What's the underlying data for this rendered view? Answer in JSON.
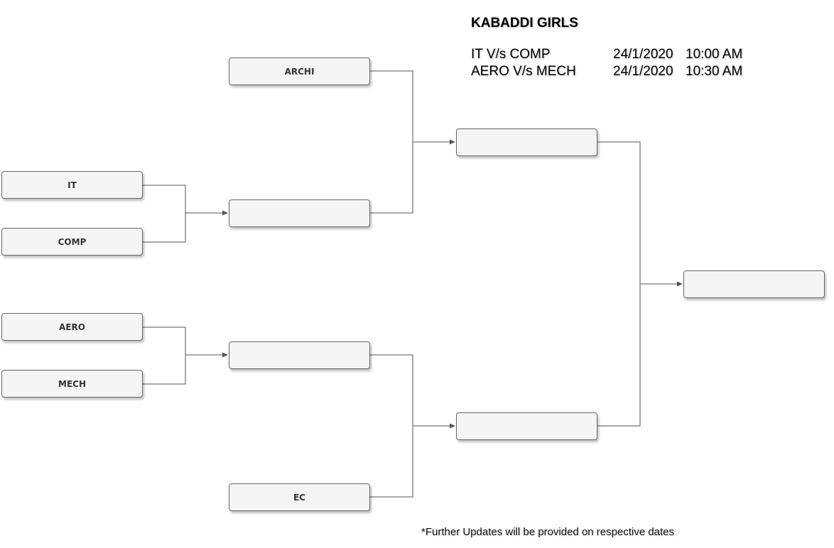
{
  "header": {
    "title": "KABADDI GIRLS"
  },
  "schedule": [
    {
      "teams": "IT V/s COMP",
      "date": "24/1/2020",
      "time": "10:00 AM"
    },
    {
      "teams": "AERO V/s MECH",
      "date": "24/1/2020",
      "time": "10:30 AM"
    }
  ],
  "bracket": {
    "round1": [
      "IT",
      "COMP",
      "AERO",
      "MECH"
    ],
    "round2": [
      "ARCHI",
      "",
      "",
      "EC"
    ],
    "semifinal": [
      "",
      ""
    ],
    "final": ""
  },
  "footnote": "*Further Updates will be provided on respective dates",
  "colors": {
    "box_fill": "#f5f5f5",
    "box_border": "#666666",
    "connector": "#555555"
  }
}
